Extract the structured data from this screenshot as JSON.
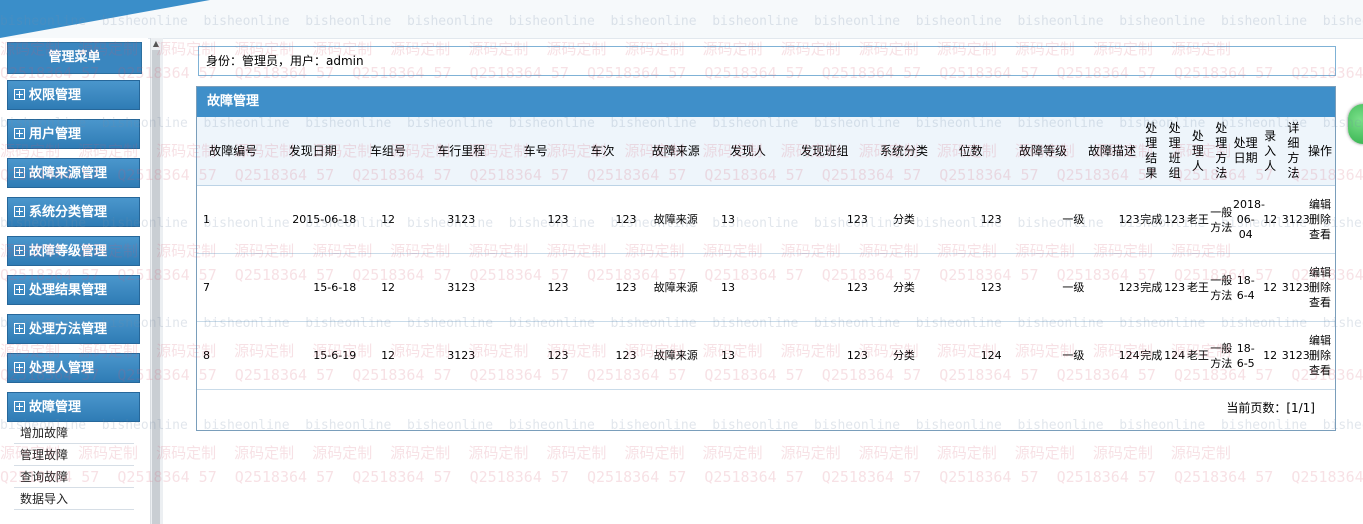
{
  "watermarks": {
    "site": "bisheonline",
    "slogan": "源码定制",
    "qq": "Q2518364 57"
  },
  "sidebar": {
    "title": "管理菜单",
    "items": [
      {
        "label": "权限管理"
      },
      {
        "label": "用户管理"
      },
      {
        "label": "故障来源管理"
      },
      {
        "label": "系统分类管理"
      },
      {
        "label": "故障等级管理"
      },
      {
        "label": "处理结果管理"
      },
      {
        "label": "处理方法管理"
      },
      {
        "label": "处理人管理"
      },
      {
        "label": "故障管理"
      }
    ],
    "subitems": [
      {
        "label": "增加故障"
      },
      {
        "label": "管理故障"
      },
      {
        "label": "查询故障"
      },
      {
        "label": "数据导入"
      }
    ]
  },
  "identity_text": "身份：管理员，用户：admin",
  "panel": {
    "title": "故障管理",
    "headers": [
      "故障编号",
      "发现日期",
      "车组号",
      "车行里程",
      "车号",
      "车次",
      "故障来源",
      "发现人",
      "发现班组",
      "系统分类",
      "位数",
      "故障等级",
      "故障描述",
      "处理结果",
      "处理班组",
      "处理人",
      "处理方法",
      "处理日期",
      "录入人",
      "详细方法",
      "操作"
    ],
    "rows": [
      {
        "id": "1",
        "date": "2015-06-18",
        "group": "12",
        "mileage": "3123",
        "car": "123",
        "train": "123",
        "source": "故障来源",
        "finder": "13",
        "team": "123",
        "sys": "分类",
        "pos": "123",
        "level": "一级",
        "desc": "123",
        "result": "完成",
        "rteam": "123",
        "handler": "老王",
        "method": "一般方法",
        "hdate": "2018-06-04",
        "entry": "12",
        "detail": "3123",
        "edit": "编辑",
        "del": "删除",
        "view": "查看"
      },
      {
        "id": "7",
        "date": "15-6-18",
        "group": "12",
        "mileage": "3123",
        "car": "123",
        "train": "123",
        "source": "故障来源",
        "finder": "13",
        "team": "123",
        "sys": "分类",
        "pos": "123",
        "level": "一级",
        "desc": "123",
        "result": "完成",
        "rteam": "123",
        "handler": "老王",
        "method": "一般方法",
        "hdate": "18-6-4",
        "entry": "12",
        "detail": "3123",
        "edit": "编辑",
        "del": "删除",
        "view": "查看"
      },
      {
        "id": "8",
        "date": "15-6-19",
        "group": "12",
        "mileage": "3123",
        "car": "123",
        "train": "123",
        "source": "故障来源",
        "finder": "13",
        "team": "123",
        "sys": "分类",
        "pos": "124",
        "level": "一级",
        "desc": "124",
        "result": "完成",
        "rteam": "124",
        "handler": "老王",
        "method": "一般方法",
        "hdate": "18-6-5",
        "entry": "12",
        "detail": "3123",
        "edit": "编辑",
        "del": "删除",
        "view": "查看"
      }
    ],
    "pager_text": "当前页数：[1/1]"
  }
}
